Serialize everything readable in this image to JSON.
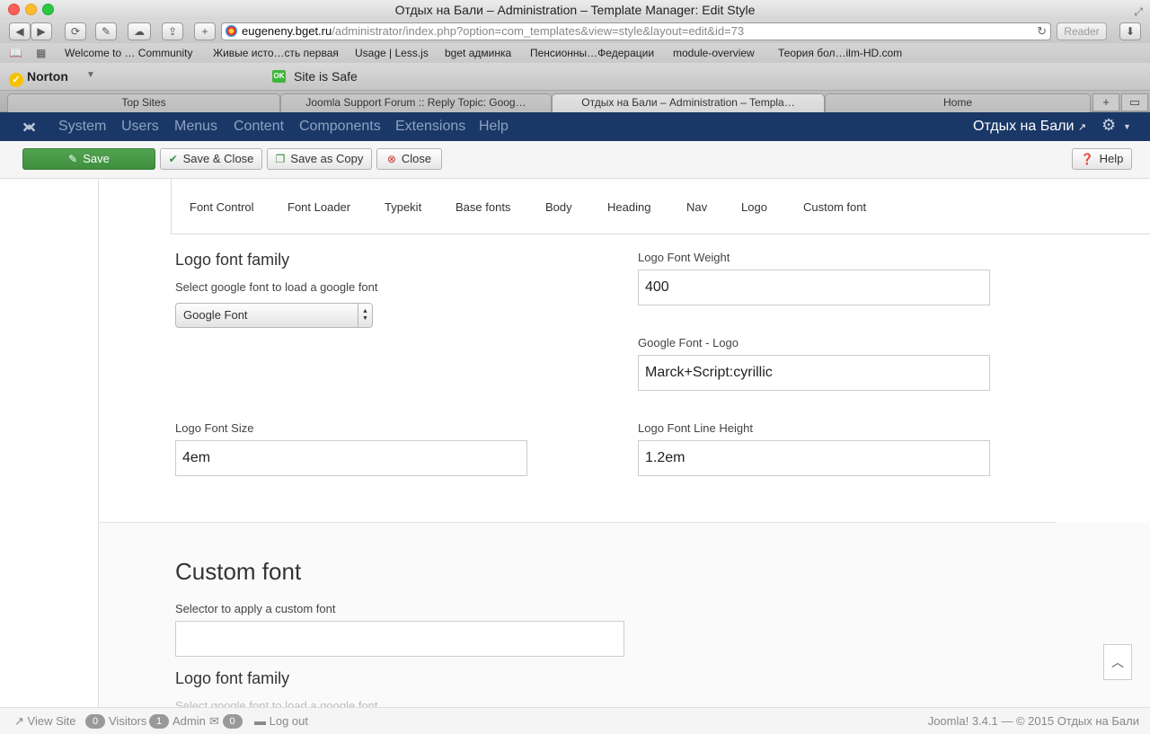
{
  "browser": {
    "window_title": "Отдых на Бали – Administration – Template Manager: Edit Style",
    "address_host": "eugeneny.bget.ru",
    "address_path": "/administrator/index.php?option=com_templates&view=style&layout=edit&id=73",
    "reader_label": "Reader",
    "bookmarks": [
      "Welcome to … Community",
      "Живые исто…сть первая",
      "Usage | Less.js",
      "bget админка",
      "Пенсионны…Федерации",
      "module-overview",
      "Теория бол…ilm-HD.com"
    ],
    "norton_label": "Norton",
    "safe_badge": "OK",
    "safe_text": "Site is Safe",
    "tabs": [
      "Top Sites",
      "Joomla Support Forum :: Reply Topic: Goog…",
      "Отдых на Бали – Administration – Templa…",
      "Home"
    ]
  },
  "nav": {
    "items": [
      "System",
      "Users",
      "Menus",
      "Content",
      "Components",
      "Extensions",
      "Help"
    ],
    "site_name": "Отдых на Бали"
  },
  "actions": {
    "save": "Save",
    "save_close": "Save & Close",
    "save_copy": "Save as Copy",
    "close": "Close",
    "help": "Help"
  },
  "font_tabs": [
    "Font Control",
    "Font Loader",
    "Typekit",
    "Base fonts",
    "Body",
    "Heading",
    "Nav",
    "Logo",
    "Custom font"
  ],
  "logo_section": {
    "family_heading": "Logo font family",
    "family_desc": "Select google font to load a google font",
    "family_value": "Google Font",
    "weight_label": "Logo Font Weight",
    "weight_value": "400",
    "google_label": "Google Font - Logo",
    "google_value": "Marck+Script:cyrillic",
    "size_label": "Logo Font Size",
    "size_value": "4em",
    "line_height_label": "Logo Font Line Height",
    "line_height_value": "1.2em"
  },
  "custom_section": {
    "heading": "Custom font",
    "selector_label": "Selector to apply a custom font",
    "selector_value": "",
    "family_heading": "Logo font family",
    "family_desc": "Select google font to load a google font"
  },
  "status": {
    "view_site": "View Site",
    "visitors_count": "0",
    "visitors_label": "Visitors",
    "admin_count": "1",
    "admin_label": "Admin",
    "messages_count": "0",
    "logout": "Log out",
    "footer": "Joomla! 3.4.1  —  © 2015 Отдых на Бали"
  }
}
